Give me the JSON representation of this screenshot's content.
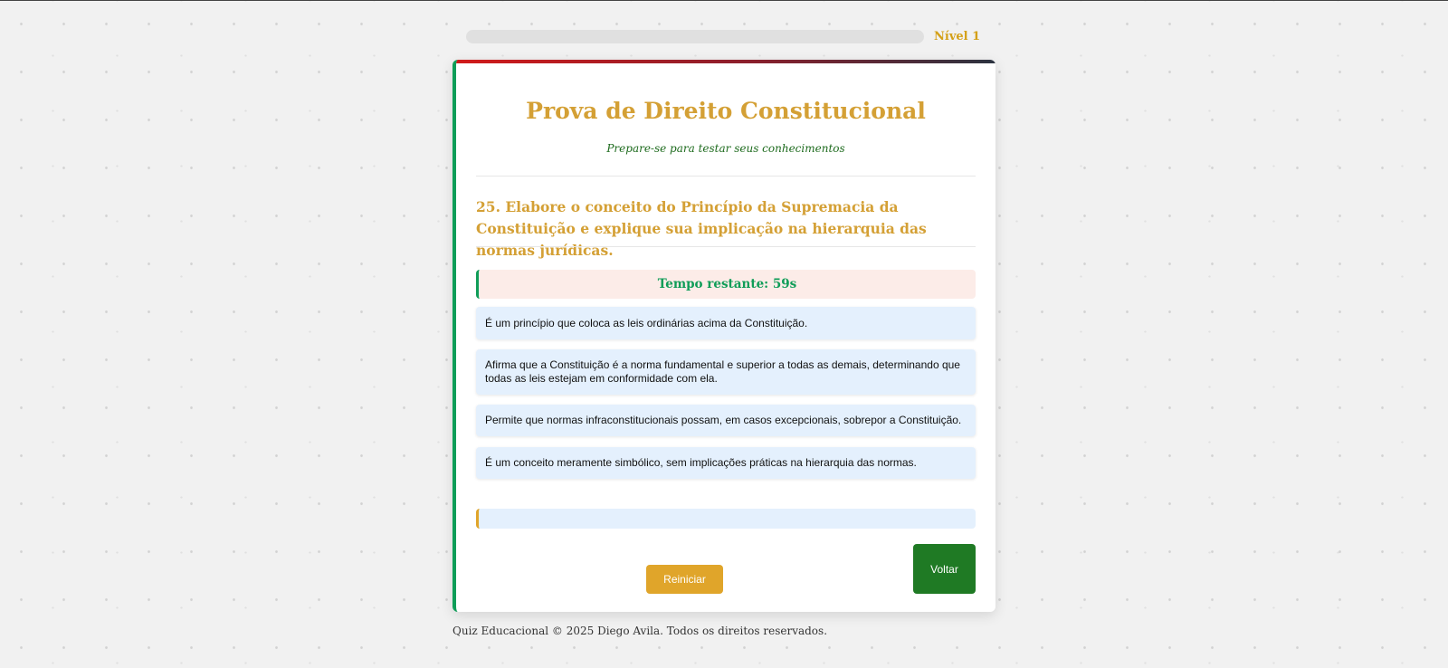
{
  "progress": {
    "level_label": "Nível 1",
    "fill_percent": 0
  },
  "header": {
    "title": "Prova de Direito Constitucional",
    "subtitle": "Prepare-se para testar seus conhecimentos"
  },
  "question": {
    "text": "25. Elabore o conceito do Princípio da Supremacia da Constituição e explique sua implicação na hierarquia das normas jurídicas."
  },
  "timer": {
    "text": "Tempo restante: 59s"
  },
  "options": [
    "É um princípio que coloca as leis ordinárias acima da Constituição.",
    "Afirma que a Constituição é a norma fundamental e superior a todas as demais, determinando que todas as leis estejam em conformidade com ela.",
    "Permite que normas infraconstitucionais possam, em casos excepcionais, sobrepor a Constituição.",
    "É um conceito meramente simbólico, sem implicações práticas na hierarquia das normas."
  ],
  "buttons": {
    "restart_label": "Reiniciar",
    "back_label": "Voltar"
  },
  "footer": {
    "text": "Quiz Educacional © 2025 Diego Avila. Todos os direitos reservados."
  },
  "colors": {
    "accent_gold": "#d4a035",
    "accent_green": "#0f9d58",
    "button_green": "#1f7a24",
    "button_gold": "#e0a52a",
    "option_bg": "#e4f0fd",
    "timer_bg": "#fcece8"
  }
}
